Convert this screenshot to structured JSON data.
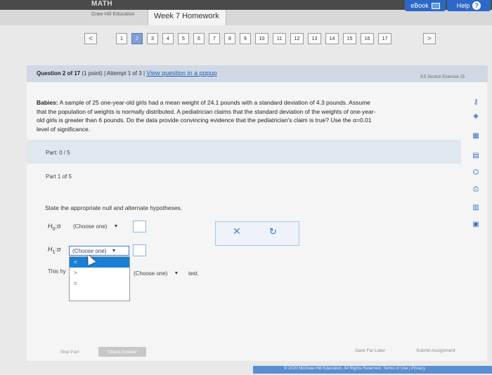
{
  "header": {
    "brand": "MATH",
    "publisher": "Graw Hill Education",
    "title": "Week 7 Homework",
    "ebook_label": "eBook",
    "help_label": "Help"
  },
  "nav": {
    "prev": "<",
    "next": ">",
    "questions": [
      "1",
      "2",
      "3",
      "4",
      "5",
      "6",
      "7",
      "8",
      "9",
      "10",
      "11",
      "12",
      "13",
      "14",
      "15",
      "16",
      "17"
    ],
    "active_index": 1
  },
  "question": {
    "label": "Question 2 of 17",
    "points": "(1 point)",
    "separator": "|",
    "attempt": "Attempt 1 of 3",
    "view_link": "View question in a popup",
    "section": "9.5 Section Exercise 15"
  },
  "problem": {
    "lead": "Babies:",
    "line1": " A sample of 25 one-year-old girls had a mean weight of 24.1 pounds with a standard deviation of 4.3 pounds. Assume",
    "line2": "that the population of weights is normally distributed. A pediatrician claims that the standard deviation of the weights of one-year-",
    "line3": "old girls is greater than 6 pounds. Do the data provide convincing evidence that the pediatrician's claim is true? Use the α=0.01",
    "line4": "level of significance."
  },
  "part": {
    "label": "Part: 0 / 5",
    "part1": "Part 1 of 5"
  },
  "instruction": "State the appropriate null and alternate hypotheses.",
  "h0": {
    "sym": "H",
    "sub": "0",
    "rest": ":σ",
    "select": "(Choose one)"
  },
  "h1": {
    "sym": "H",
    "sub": "1",
    "rest": ":σ",
    "select": "(Choose one)"
  },
  "dropdown": {
    "options": [
      "<",
      ">",
      "="
    ]
  },
  "this_hy": "This hy",
  "choose_test": "(Choose one)",
  "test_label": "test.",
  "buttons": {
    "skip": "Skip Part",
    "check": "Check Answer",
    "save": "Save For Later",
    "submit": "Submit Assignment"
  },
  "footer": {
    "copyright": "© 2020 McGraw-Hill Education. All Rights Reserved.",
    "terms": "Terms of Use",
    "sep": "|",
    "privacy": "Privacy"
  },
  "colors": {
    "accent": "#2b68c9",
    "active_page": "#7f9fd4",
    "dropdown_highlight": "#1a7fd6"
  }
}
